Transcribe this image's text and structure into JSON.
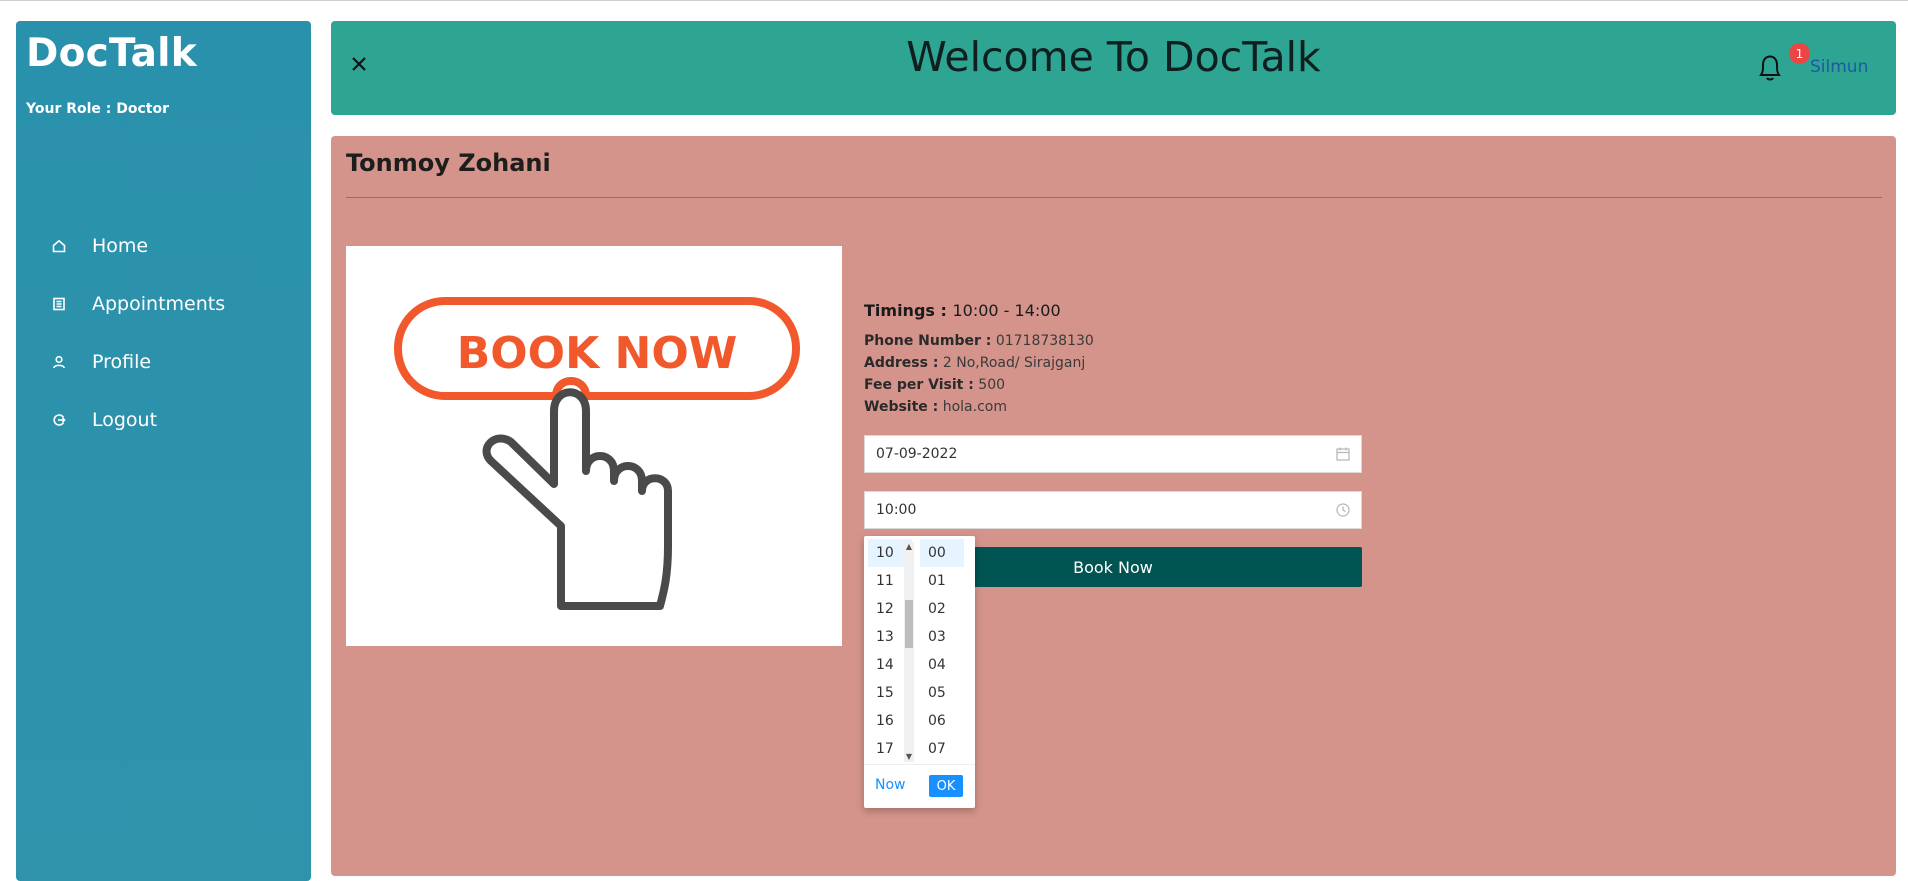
{
  "sidebar": {
    "brand": "DocTalk",
    "role": "Your Role : Doctor",
    "items": [
      {
        "label": "Home",
        "icon": "home-icon"
      },
      {
        "label": "Appointments",
        "icon": "list-icon"
      },
      {
        "label": "Profile",
        "icon": "user-icon"
      },
      {
        "label": "Logout",
        "icon": "logout-icon"
      }
    ]
  },
  "header": {
    "title": "Welcome To DocTalk",
    "notification_count": "1",
    "user": "Silmun"
  },
  "doctor": {
    "name": "Tonmoy Zohani",
    "banner_text": "BOOK NOW",
    "timings_label": "Timings :",
    "timings_value": "10:00 - 14:00",
    "phone_label": "Phone Number :",
    "phone": "01718738130",
    "address_label": "Address :",
    "address": "2 No,Road/ Sirajganj",
    "fee_label": "Fee per Visit :",
    "fee": "500",
    "website_label": "Website :",
    "website": "hola.com"
  },
  "form": {
    "date_value": "07-09-2022",
    "time_value": "10:00",
    "book_label": "Book Now"
  },
  "picker": {
    "hours": [
      "10",
      "11",
      "12",
      "13",
      "14",
      "15",
      "16",
      "17"
    ],
    "minutes": [
      "00",
      "01",
      "02",
      "03",
      "04",
      "05",
      "06",
      "07"
    ],
    "selected_hour": "10",
    "selected_minute": "00",
    "now_label": "Now",
    "ok_label": "OK"
  },
  "colors": {
    "sidebar": "#2a91ac",
    "header": "#2ea493",
    "card": "#d4948b",
    "button": "#005452",
    "accent": "#1890ff",
    "badge": "#ec4545",
    "banner_orange": "#f1582b"
  }
}
